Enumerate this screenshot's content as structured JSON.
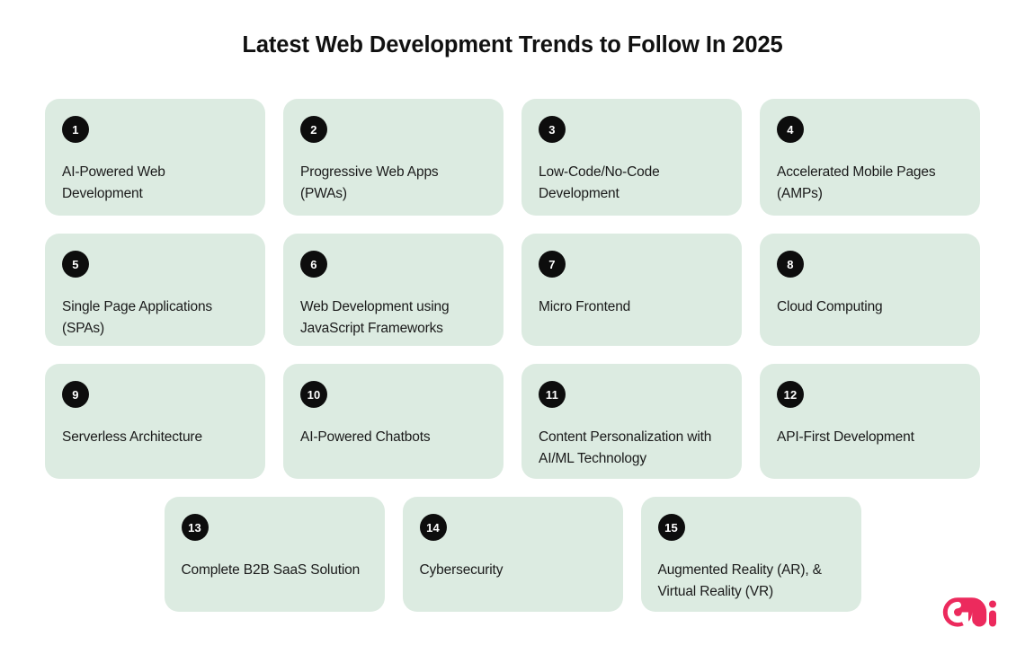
{
  "header": {
    "title": "Latest Web Development Trends to Follow In 2025"
  },
  "theme": {
    "page_background": "#ffffff",
    "card_background": "#dcebe1",
    "badge_background": "#0d0d0d",
    "badge_text_color": "#ffffff",
    "title_color": "#111111",
    "card_text_color": "#1a1a1a",
    "logo_color": "#ec2a5d"
  },
  "rows": [
    {
      "cards": [
        {
          "number": "1",
          "label": "AI-Powered Web Development"
        },
        {
          "number": "2",
          "label": "Progressive Web Apps (PWAs)"
        },
        {
          "number": "3",
          "label": "Low-Code/No-Code Development"
        },
        {
          "number": "4",
          "label": "Accelerated Mobile Pages (AMPs)"
        }
      ]
    },
    {
      "cards": [
        {
          "number": "5",
          "label": "Single Page Applications (SPAs)"
        },
        {
          "number": "6",
          "label": "Web Development using JavaScript Frameworks"
        },
        {
          "number": "7",
          "label": "Micro Frontend"
        },
        {
          "number": "8",
          "label": "Cloud Computing"
        }
      ]
    },
    {
      "cards": [
        {
          "number": "9",
          "label": "Serverless Architecture"
        },
        {
          "number": "10",
          "label": "AI-Powered Chatbots"
        },
        {
          "number": "11",
          "label": "Content Personalization with AI/ML Technology"
        },
        {
          "number": "12",
          "label": "API-First Development"
        }
      ]
    },
    {
      "cards": [
        {
          "number": "13",
          "label": "Complete B2B SaaS Solution"
        },
        {
          "number": "14",
          "label": "Cybersecurity"
        },
        {
          "number": "15",
          "label": "Augmented Reality (AR), & Virtual Reality (VR)"
        }
      ]
    }
  ],
  "logo": {
    "name": "mi-logo",
    "color": "#ec2a5d"
  }
}
